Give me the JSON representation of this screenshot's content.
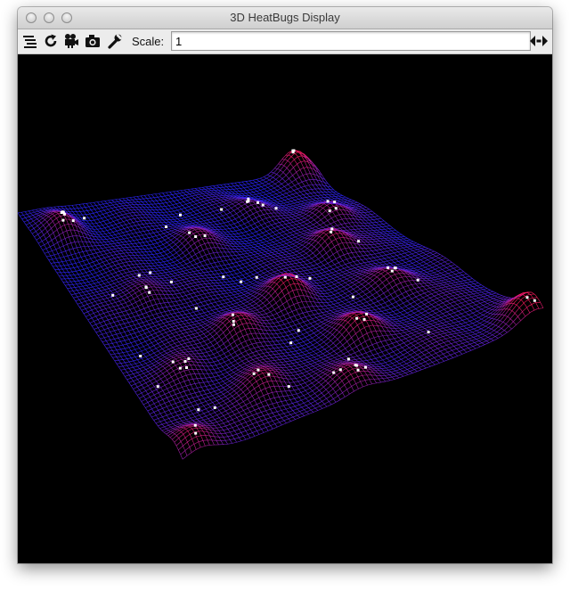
{
  "window": {
    "title": "3D HeatBugs Display"
  },
  "toolbar": {
    "layers_icon": "layers-icon",
    "refresh_icon": "refresh-icon",
    "movie_icon": "movie-camera-icon",
    "snapshot_icon": "camera-icon",
    "options_icon": "wrench-icon",
    "scale_label": "Scale:",
    "scale_value": "1",
    "resize_icon": "double-arrow-icon"
  },
  "colors": {
    "background": "#000000",
    "mesh_low": "#2a24ff",
    "mesh_high": "#ff1a5e",
    "bugs": "#ffffff"
  }
}
